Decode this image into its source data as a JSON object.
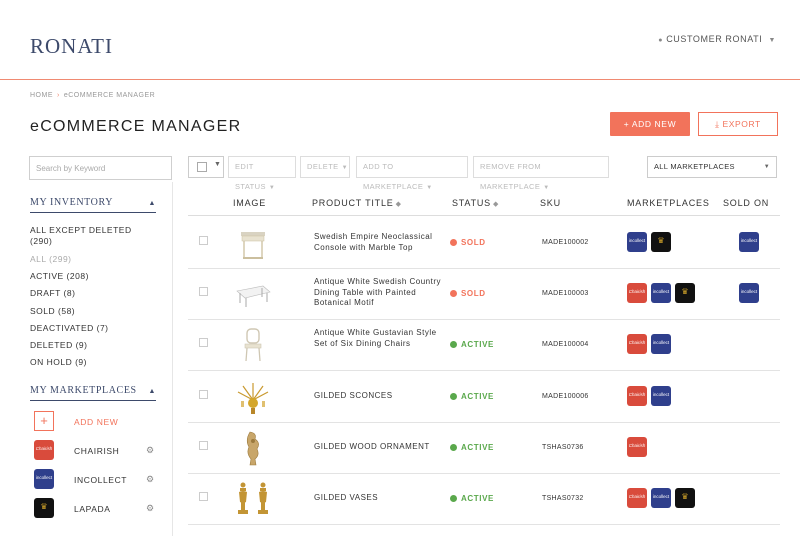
{
  "header": {
    "logo": "RONATI",
    "user": "CUSTOMER RONATI"
  },
  "breadcrumb": {
    "home": "HOME",
    "current": "eCOMMERCE MANAGER"
  },
  "page_title": "eCOMMERCE MANAGER",
  "actions": {
    "add_new": "+ ADD NEW",
    "export": "EXPORT"
  },
  "search": {
    "placeholder": "Search by Keyword"
  },
  "toolbar": {
    "edit_status": "EDIT STATUS",
    "delete": "DELETE",
    "add_to_marketplace": "ADD TO MARKETPLACE",
    "remove_from_marketplace": "REMOVE FROM MARKETPLACE",
    "marketplace_filter": "ALL MARKETPLACES"
  },
  "sidebar": {
    "inventory_title": "MY INVENTORY",
    "inventory_items": [
      {
        "label": "ALL EXCEPT DELETED (290)"
      },
      {
        "label": "ALL (299)"
      },
      {
        "label": "ACTIVE (208)"
      },
      {
        "label": "DRAFT (8)"
      },
      {
        "label": "SOLD (58)"
      },
      {
        "label": "DEACTIVATED (7)"
      },
      {
        "label": "DELETED (9)"
      },
      {
        "label": "ON HOLD (9)"
      }
    ],
    "marketplaces_title": "MY MARKETPLACES",
    "add_new": "ADD NEW",
    "marketplaces": [
      {
        "label": "CHAIRISH",
        "icon": "chairish-logo"
      },
      {
        "label": "INCOLLECT",
        "icon": "incollect-logo"
      },
      {
        "label": "LAPADA",
        "icon": "lapada-logo"
      }
    ]
  },
  "table": {
    "headers": {
      "image": "IMAGE",
      "title": "PRODUCT TITLE",
      "status": "STATUS",
      "sku": "SKU",
      "marketplaces": "MARKETPLACES",
      "sold_on": "SOLD ON"
    },
    "rows": [
      {
        "title": "Swedish Empire Neoclassical Console with Marble Top",
        "status": "SOLD",
        "sku": "MADE100002",
        "marketplaces": [
          "incollect",
          "lapada"
        ],
        "sold_on": "incollect"
      },
      {
        "title": "Antique White Swedish Country Dining Table with Painted Botanical Motif",
        "status": "SOLD",
        "sku": "MADE100003",
        "marketplaces": [
          "chairish",
          "incollect",
          "lapada"
        ],
        "sold_on": "incollect"
      },
      {
        "title": "Antique White Gustavian Style Set of Six Dining Chairs",
        "status": "ACTIVE",
        "sku": "MADE100004",
        "marketplaces": [
          "chairish",
          "incollect"
        ],
        "sold_on": ""
      },
      {
        "title": "GILDED SCONCES",
        "status": "ACTIVE",
        "sku": "MADE100006",
        "marketplaces": [
          "chairish",
          "incollect"
        ],
        "sold_on": ""
      },
      {
        "title": "GILDED WOOD ORNAMENT",
        "status": "ACTIVE",
        "sku": "TSHAS0736",
        "marketplaces": [
          "chairish"
        ],
        "sold_on": ""
      },
      {
        "title": "GILDED VASES",
        "status": "ACTIVE",
        "sku": "TSHAS0732",
        "marketplaces": [
          "chairish",
          "incollect",
          "lapada"
        ],
        "sold_on": ""
      }
    ]
  },
  "colors": {
    "accent": "#f2735b",
    "brand": "#3d4a6b",
    "sold": "#f2735b",
    "active": "#5aa84c",
    "chairish": "#d94b3c",
    "incollect": "#2f3f8c",
    "lapada": "#111111"
  }
}
